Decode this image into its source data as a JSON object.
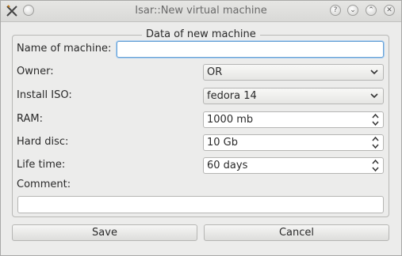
{
  "window": {
    "title": "Isar::New virtual machine"
  },
  "titlebar": {
    "buttons": {
      "help": "?",
      "minimize": "⌄",
      "maximize": "⌃",
      "close": "✕"
    }
  },
  "form": {
    "group_title": "Data of new machine",
    "name": {
      "label": "Name of machine:",
      "value": "",
      "placeholder": ""
    },
    "owner": {
      "label": "Owner:",
      "value": "OR"
    },
    "iso": {
      "label": "Install ISO:",
      "value": "fedora 14"
    },
    "ram": {
      "label": "RAM:",
      "value": "1000 mb"
    },
    "disc": {
      "label": "Hard disc:",
      "value": "10 Gb"
    },
    "life": {
      "label": "Life time:",
      "value": "60 days"
    },
    "comment": {
      "label": "Comment:",
      "value": ""
    }
  },
  "buttons": {
    "save": "Save",
    "cancel": "Cancel"
  },
  "icons": {
    "app": "x-tools-icon",
    "help": "help-icon",
    "minimize": "minimize-icon",
    "maximize": "maximize-icon",
    "close": "close-icon",
    "combo_arrow": "chevron-down-icon",
    "spin_arrows": "spin-updown-icon"
  },
  "colors": {
    "focus_border": "#6aa3d6",
    "window_bg": "#ececeb"
  }
}
